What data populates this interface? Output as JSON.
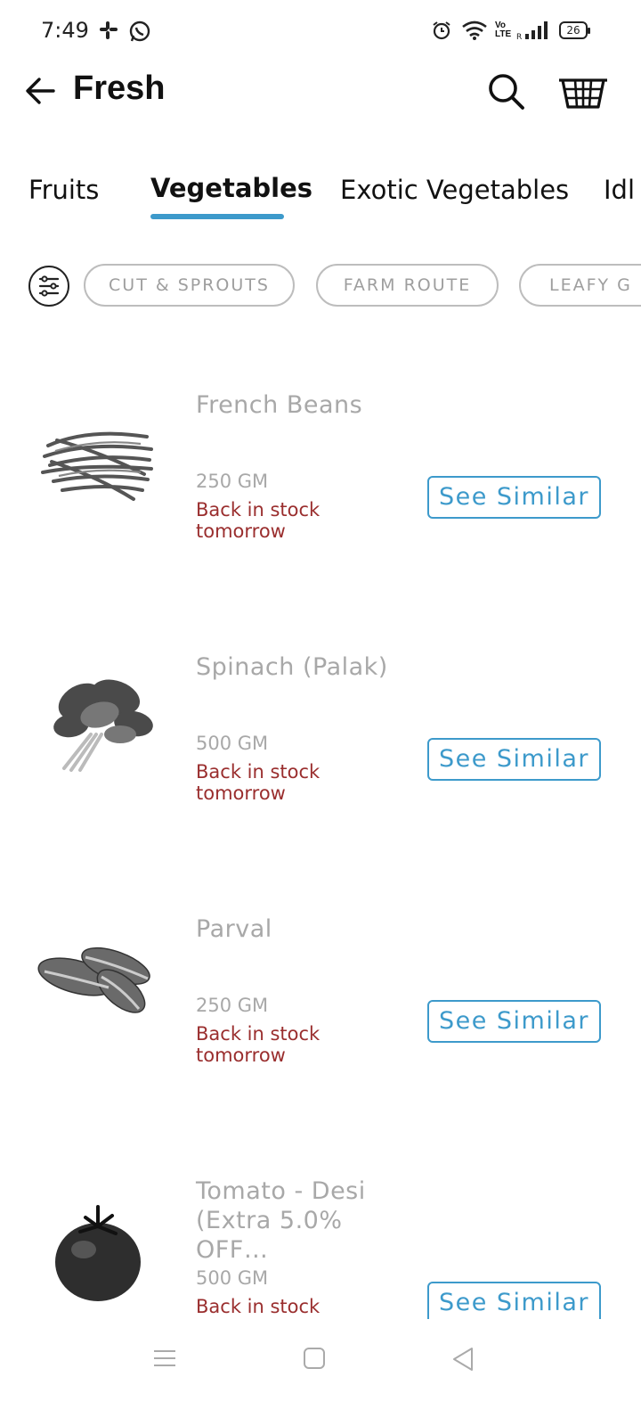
{
  "status_bar": {
    "time": "7:49",
    "battery": "26",
    "icons": [
      "slack-icon",
      "whatsapp-icon",
      "alarm-icon",
      "wifi-icon",
      "volte-icon",
      "signal-icon",
      "battery-icon"
    ]
  },
  "app_bar": {
    "title": "Fresh",
    "icons": [
      "back-arrow-icon",
      "search-icon",
      "basket-icon"
    ]
  },
  "tabs": [
    {
      "label": "Fruits",
      "active": false
    },
    {
      "label": "Vegetables",
      "active": true
    },
    {
      "label": "Exotic Vegetables",
      "active": false
    },
    {
      "label": "Idl",
      "active": false
    }
  ],
  "chips": [
    "CUT & SPROUTS",
    "FARM ROUTE",
    "LEAFY G"
  ],
  "products": [
    {
      "name": "French Beans",
      "qty": "250 GM",
      "stock": "Back in stock tomorrow",
      "action": "See Similar"
    },
    {
      "name": "Spinach (Palak)",
      "qty": "500 GM",
      "stock": "Back in stock tomorrow",
      "action": "See Similar"
    },
    {
      "name": "Parval",
      "qty": "250 GM",
      "stock": "Back in stock tomorrow",
      "action": "See Similar"
    },
    {
      "name": "Tomato - Desi (Extra 5.0% OFF…",
      "qty": "500 GM",
      "stock": "Back in stock tomorrow",
      "action": "See Similar"
    }
  ],
  "colors": {
    "accent": "#3d9acb",
    "out_of_stock": "#9a2e2e",
    "muted_text": "#a8a8a8"
  }
}
